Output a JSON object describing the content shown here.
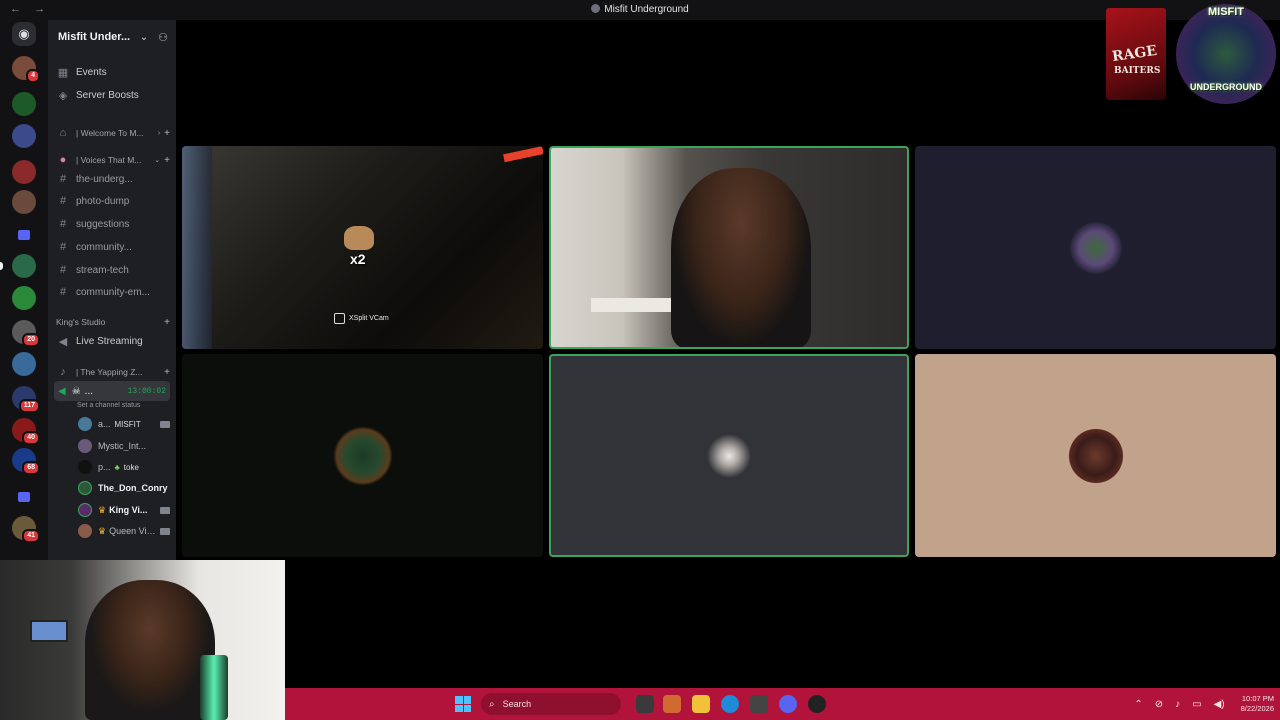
{
  "window": {
    "title": "Misfit Underground",
    "back": "←",
    "forward": "→"
  },
  "servers": [
    {
      "id": "home",
      "badge": ""
    },
    {
      "id": "s1",
      "badge": "4",
      "color": "#7a4a3a"
    },
    {
      "id": "s2",
      "badge": "",
      "color": "#1d5a2a"
    },
    {
      "id": "s3",
      "badge": "",
      "color": "#3a4a8a"
    },
    {
      "id": "s4",
      "badge": "",
      "color": "#8a2a2a"
    },
    {
      "id": "s5",
      "badge": "",
      "color": "#6a4a3a"
    },
    {
      "id": "s6",
      "badge": "",
      "color": "#2a6a4a"
    },
    {
      "id": "s7",
      "badge": "",
      "color": "#2a8a3a"
    },
    {
      "id": "s8",
      "badge": "20",
      "color": "#5a5a5a"
    },
    {
      "id": "s9",
      "badge": "",
      "color": "#3a6a9a"
    },
    {
      "id": "s10",
      "badge": "117",
      "color": "#2a3a6a"
    },
    {
      "id": "s11",
      "badge": "40",
      "color": "#8a1a1a"
    },
    {
      "id": "s12",
      "badge": "68",
      "color": "#1a3a8a"
    },
    {
      "id": "s13",
      "badge": "41",
      "color": "#6a5a3a"
    }
  ],
  "sidebar": {
    "guild_name": "Misfit Under...",
    "events": "Events",
    "boosts": "Server Boosts",
    "categories": {
      "welcome": "| Welcome To M...",
      "voices": "| Voices That M...",
      "kings": "King's Studio",
      "yapping": "| The Yapping Z..."
    },
    "channels": {
      "c1": "the-underg...",
      "c2": "photo-dump",
      "c3": "suggestions",
      "c4": "community...",
      "c5": "stream-tech",
      "c6": "community-em...",
      "live": "Live Streaming"
    },
    "voice": {
      "active_channel": "...",
      "timer": "13:00:02",
      "status": "Set a channel status",
      "users": [
        {
          "name": "a...",
          "extra": "MISFIT",
          "cam": true
        },
        {
          "name": "Mystic_Int...",
          "extra": "",
          "cam": false
        },
        {
          "name": "p...",
          "extra": "toke",
          "cam": false
        },
        {
          "name": "The_Don_Conry",
          "extra": "",
          "cam": false
        },
        {
          "name": "King Vi...",
          "extra": "",
          "cam": true
        },
        {
          "name": "Queen Viol...",
          "extra": "",
          "cam": true
        }
      ]
    }
  },
  "stage": {
    "tile1": {
      "overlay_multiplier": "x2",
      "software_label": "XSplit VCam"
    },
    "logos": {
      "book_line1": "RAGE",
      "book_line2": "BAITERS",
      "misfit_top": "MISFIT",
      "misfit_bottom": "UNDERGROUND"
    }
  },
  "taskbar": {
    "search_placeholder": "Search",
    "time": "10:07 PM",
    "date": "8/22/2026",
    "accent": "#b2133b"
  }
}
